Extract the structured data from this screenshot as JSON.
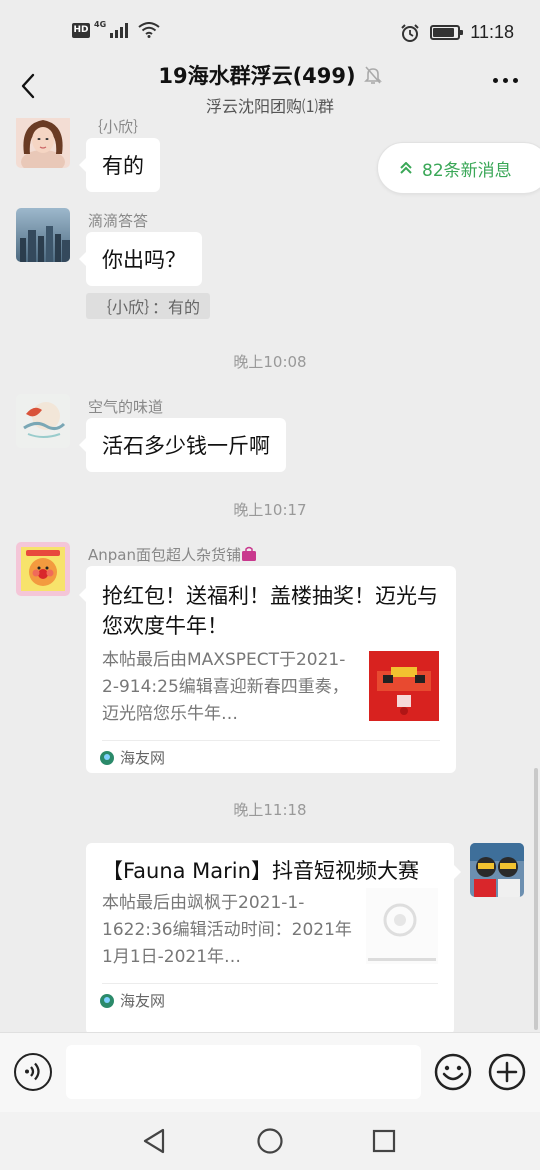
{
  "status_bar": {
    "hd_badge": "HD",
    "network": "4G",
    "time": "11:18",
    "battery_level": 0.85
  },
  "header": {
    "title": "19海水群浮云(499)",
    "subtitle": "浮云沈阳团购⑴群"
  },
  "new_messages": {
    "label": "82条新消息",
    "color": "#3aa757"
  },
  "messages": [
    {
      "sender": "｛小欣｝",
      "text": "有的"
    },
    {
      "sender": "滴滴答答",
      "text": "你出吗？",
      "quote": "｛小欣｝：有的"
    },
    {
      "timestamp": "晚上10:08"
    },
    {
      "sender": "空气的味道",
      "text": "活石多少钱一斤啊"
    },
    {
      "timestamp": "晚上10:17"
    },
    {
      "sender": "Anpan面包超人杂货铺",
      "card": {
        "title": "抢红包！送福利！盖楼抽奖！迈光与您欢度牛年！",
        "description": "本帖最后由MAXSPECT于2021-2-914:25编辑喜迎新春四重奏，迈光陪您乐牛年…",
        "source": "海友网"
      }
    },
    {
      "timestamp": "晚上11:18"
    },
    {
      "self": true,
      "card": {
        "title": "【Fauna Marin】抖音短视频大赛",
        "description": "本帖最后由飒枫于2021-1-1622:36编辑活动时间：2021年1月1日-2021年…",
        "source": "海友网"
      }
    }
  ],
  "input_bar": {
    "placeholder": ""
  },
  "icons": {
    "back": "chevron-left-icon",
    "mute": "bell-off-icon",
    "more": "more-dots-icon",
    "voice": "voice-icon",
    "emoji": "emoji-icon",
    "plus": "plus-icon",
    "nav_back": "triangle-back-icon",
    "nav_home": "circle-home-icon",
    "nav_recents": "square-recents-icon"
  }
}
